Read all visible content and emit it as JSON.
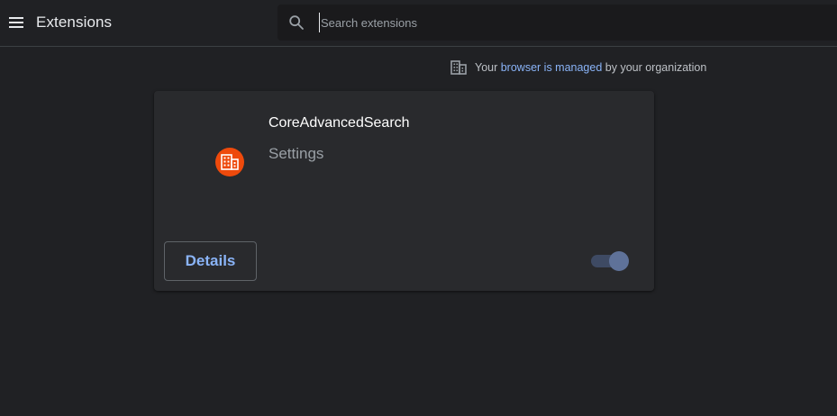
{
  "toolbar": {
    "title": "Extensions",
    "menu_icon": "hamburger-menu-icon",
    "search": {
      "icon": "search-icon",
      "placeholder": "Search extensions",
      "value": ""
    }
  },
  "managed_notice": {
    "icon": "building-icon",
    "prefix": "Your ",
    "link_text": "browser is managed",
    "suffix": " by your organization"
  },
  "extensions": [
    {
      "name": "CoreAdvancedSearch",
      "description": "Settings",
      "icon": "building-icon",
      "icon_color": "#ee4a0c",
      "details_label": "Details",
      "enabled": true
    }
  ],
  "colors": {
    "background": "#202124",
    "card": "#292a2d",
    "link": "#8ab4f8",
    "toggle_track": "#3e4a63",
    "toggle_thumb": "#5f7299"
  }
}
